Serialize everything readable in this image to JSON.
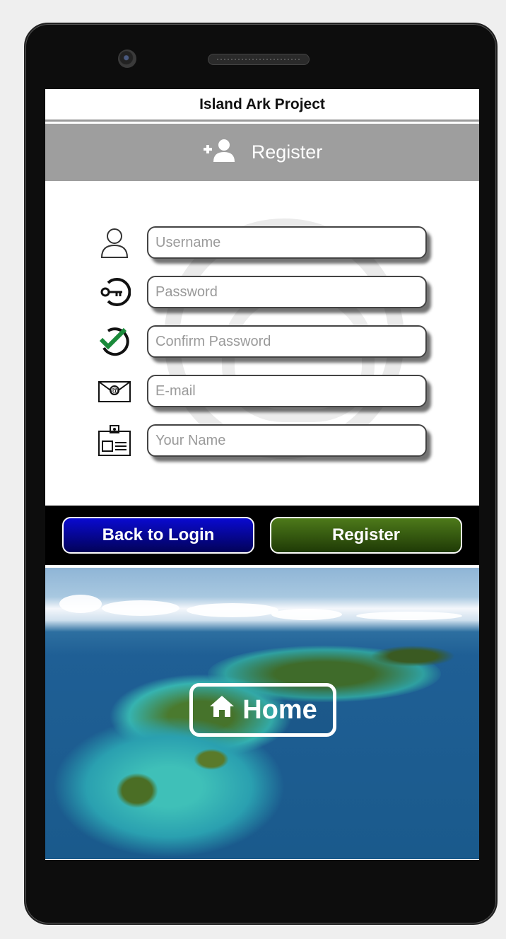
{
  "app": {
    "title": "Island Ark Project"
  },
  "header": {
    "title": "Register",
    "icon": "add-user-icon"
  },
  "form": {
    "fields": [
      {
        "placeholder": "Username",
        "icon": "user-icon"
      },
      {
        "placeholder": "Password",
        "icon": "key-icon"
      },
      {
        "placeholder": "Confirm Password",
        "icon": "check-icon"
      },
      {
        "placeholder": "E-mail",
        "icon": "email-icon"
      },
      {
        "placeholder": "Your Name",
        "icon": "id-card-icon"
      }
    ]
  },
  "buttons": {
    "back": "Back to Login",
    "register": "Register"
  },
  "home": {
    "label": "Home",
    "icon": "home-icon"
  },
  "colors": {
    "header_bg": "#9e9e9e",
    "back_btn": "#0a0ad0",
    "register_btn": "#4d7a1a",
    "check_accent": "#1a8a3a"
  }
}
